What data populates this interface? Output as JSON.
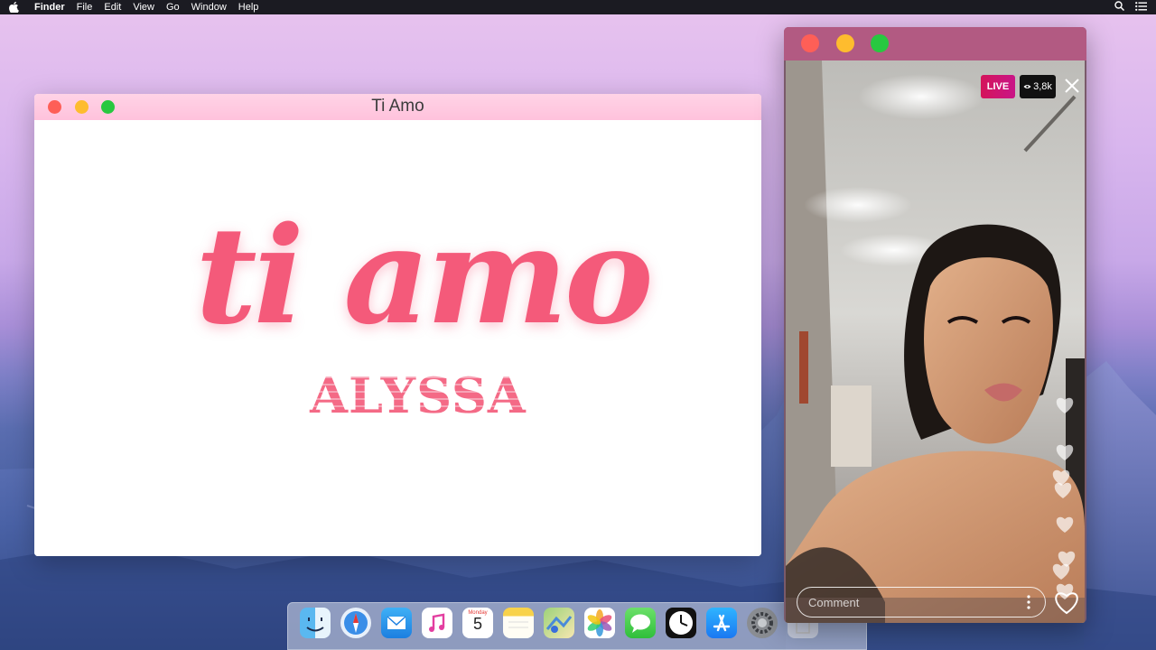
{
  "menubar": {
    "app_name": "Finder",
    "menus": [
      "File",
      "Edit",
      "View",
      "Go",
      "Window",
      "Help"
    ],
    "right_icons": [
      "search-icon",
      "list-icon"
    ]
  },
  "main_window": {
    "title": "Ti Amo",
    "artwork": {
      "script_title": "ti amo",
      "artist": "ALYSSA"
    }
  },
  "live_window": {
    "live_label": "LIVE",
    "viewer_count": "3,8k",
    "comment_placeholder": "Comment",
    "floating_hearts": 8
  },
  "dock": {
    "apps": [
      "finder-icon",
      "safari-icon",
      "mail-icon",
      "itunes-icon",
      "calendar-icon",
      "notes-icon",
      "maps-icon",
      "photos-icon",
      "messages-icon",
      "clock-icon",
      "app-store-icon",
      "system-preferences-icon",
      "trash-icon"
    ],
    "calendar": {
      "day_name": "Monday",
      "date": "5"
    }
  },
  "colors": {
    "accent_pink": "#f45a7a",
    "title_bar_pink": "#ffc2dc",
    "live_red": "#d4145a",
    "live_window_bar": "#b25a82"
  }
}
